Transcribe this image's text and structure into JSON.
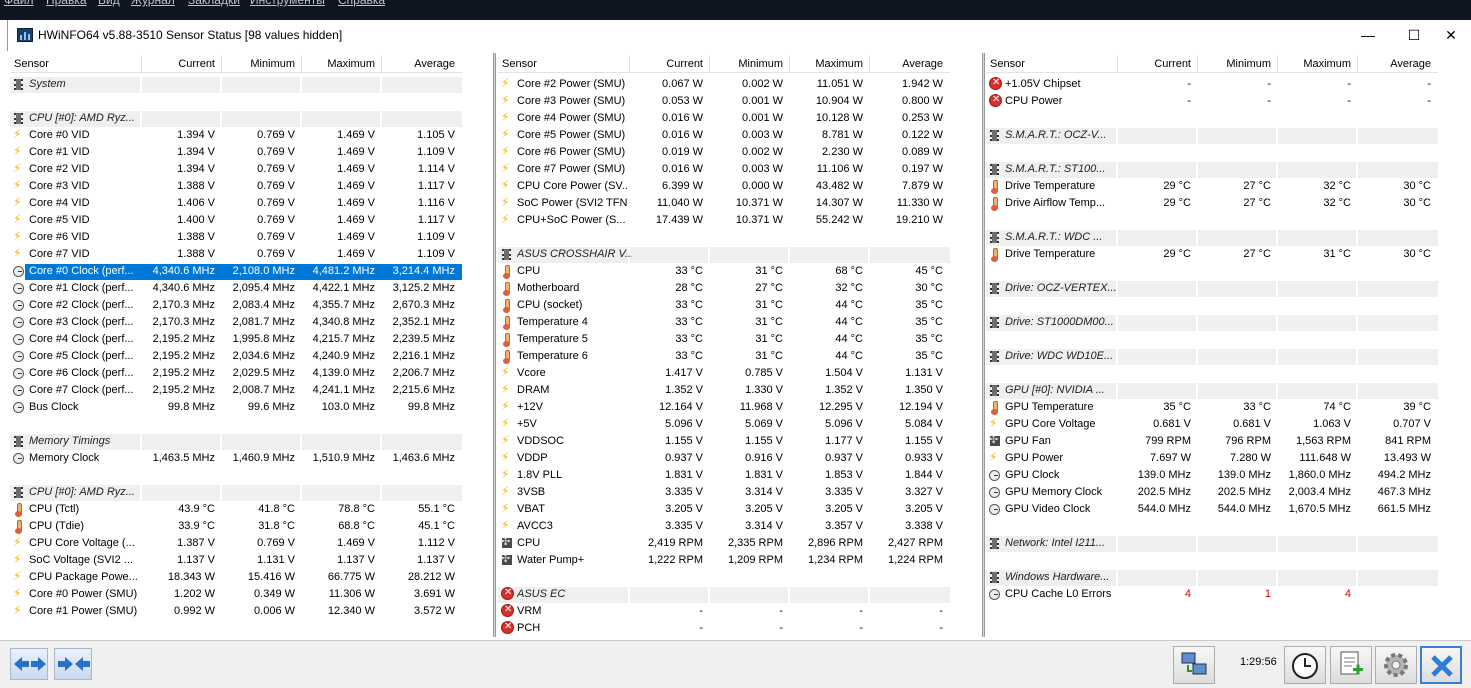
{
  "menu": [
    "Файл",
    "Правка",
    "Вид",
    "Журнал",
    "Закладки",
    "Инструменты",
    "Справка"
  ],
  "window": {
    "title": "HWiNFO64 v5.88-3510 Sensor Status [98 values hidden]",
    "minimize": "—",
    "maximize": "☐",
    "close": "✕"
  },
  "columns": {
    "sensor": "Sensor",
    "current": "Current",
    "minimum": "Minimum",
    "maximum": "Maximum",
    "average": "Average"
  },
  "panes": [
    {
      "rows": [
        {
          "type": "group",
          "name": "System"
        },
        {
          "type": "blank"
        },
        {
          "type": "group",
          "name": "CPU [#0]: AMD Ryz..."
        },
        {
          "icon": "bolt",
          "name": "Core #0 VID",
          "cur": "1.394 V",
          "min": "0.769 V",
          "max": "1.469 V",
          "avg": "1.105 V"
        },
        {
          "icon": "bolt",
          "name": "Core #1 VID",
          "cur": "1.394 V",
          "min": "0.769 V",
          "max": "1.469 V",
          "avg": "1.109 V"
        },
        {
          "icon": "bolt",
          "name": "Core #2 VID",
          "cur": "1.394 V",
          "min": "0.769 V",
          "max": "1.469 V",
          "avg": "1.114 V"
        },
        {
          "icon": "bolt",
          "name": "Core #3 VID",
          "cur": "1.388 V",
          "min": "0.769 V",
          "max": "1.469 V",
          "avg": "1.117 V"
        },
        {
          "icon": "bolt",
          "name": "Core #4 VID",
          "cur": "1.406 V",
          "min": "0.769 V",
          "max": "1.469 V",
          "avg": "1.116 V"
        },
        {
          "icon": "bolt",
          "name": "Core #5 VID",
          "cur": "1.400 V",
          "min": "0.769 V",
          "max": "1.469 V",
          "avg": "1.117 V"
        },
        {
          "icon": "bolt",
          "name": "Core #6 VID",
          "cur": "1.388 V",
          "min": "0.769 V",
          "max": "1.469 V",
          "avg": "1.109 V"
        },
        {
          "icon": "bolt",
          "name": "Core #7 VID",
          "cur": "1.388 V",
          "min": "0.769 V",
          "max": "1.469 V",
          "avg": "1.109 V"
        },
        {
          "icon": "clock",
          "name": "Core #0 Clock (perf...",
          "cur": "4,340.6 MHz",
          "min": "2,108.0 MHz",
          "max": "4,481.2 MHz",
          "avg": "3,214.4 MHz",
          "selected": true
        },
        {
          "icon": "clock",
          "name": "Core #1 Clock (perf...",
          "cur": "4,340.6 MHz",
          "min": "2,095.4 MHz",
          "max": "4,422.1 MHz",
          "avg": "3,125.2 MHz"
        },
        {
          "icon": "clock",
          "name": "Core #2 Clock (perf...",
          "cur": "2,170.3 MHz",
          "min": "2,083.4 MHz",
          "max": "4,355.7 MHz",
          "avg": "2,670.3 MHz"
        },
        {
          "icon": "clock",
          "name": "Core #3 Clock (perf...",
          "cur": "2,170.3 MHz",
          "min": "2,081.7 MHz",
          "max": "4,340.8 MHz",
          "avg": "2,352.1 MHz"
        },
        {
          "icon": "clock",
          "name": "Core #4 Clock (perf...",
          "cur": "2,195.2 MHz",
          "min": "1,995.8 MHz",
          "max": "4,215.7 MHz",
          "avg": "2,239.5 MHz"
        },
        {
          "icon": "clock",
          "name": "Core #5 Clock (perf...",
          "cur": "2,195.2 MHz",
          "min": "2,034.6 MHz",
          "max": "4,240.9 MHz",
          "avg": "2,216.1 MHz"
        },
        {
          "icon": "clock",
          "name": "Core #6 Clock (perf...",
          "cur": "2,195.2 MHz",
          "min": "2,029.5 MHz",
          "max": "4,139.0 MHz",
          "avg": "2,206.7 MHz"
        },
        {
          "icon": "clock",
          "name": "Core #7 Clock (perf...",
          "cur": "2,195.2 MHz",
          "min": "2,008.7 MHz",
          "max": "4,241.1 MHz",
          "avg": "2,215.6 MHz"
        },
        {
          "icon": "clock",
          "name": "Bus Clock",
          "cur": "99.8 MHz",
          "min": "99.6 MHz",
          "max": "103.0 MHz",
          "avg": "99.8 MHz"
        },
        {
          "type": "blank"
        },
        {
          "type": "group",
          "name": "Memory Timings"
        },
        {
          "icon": "clock",
          "name": "Memory Clock",
          "cur": "1,463.5 MHz",
          "min": "1,460.9 MHz",
          "max": "1,510.9 MHz",
          "avg": "1,463.6 MHz"
        },
        {
          "type": "blank"
        },
        {
          "type": "group",
          "name": "CPU [#0]: AMD Ryz..."
        },
        {
          "icon": "therm",
          "name": "CPU (Tctl)",
          "cur": "43.9 °C",
          "min": "41.8 °C",
          "max": "78.8 °C",
          "avg": "55.1 °C"
        },
        {
          "icon": "therm",
          "name": "CPU (Tdie)",
          "cur": "33.9 °C",
          "min": "31.8 °C",
          "max": "68.8 °C",
          "avg": "45.1 °C"
        },
        {
          "icon": "bolt",
          "name": "CPU Core Voltage (...",
          "cur": "1.387 V",
          "min": "0.769 V",
          "max": "1.469 V",
          "avg": "1.112 V"
        },
        {
          "icon": "bolt",
          "name": "SoC Voltage (SVI2 ...",
          "cur": "1.137 V",
          "min": "1.131 V",
          "max": "1.137 V",
          "avg": "1.137 V"
        },
        {
          "icon": "bolt",
          "name": "CPU Package Powe...",
          "cur": "18.343 W",
          "min": "15.416 W",
          "max": "66.775 W",
          "avg": "28.212 W"
        },
        {
          "icon": "bolt",
          "name": "Core #0 Power (SMU)",
          "cur": "1.202 W",
          "min": "0.349 W",
          "max": "11.306 W",
          "avg": "3.691 W"
        },
        {
          "icon": "bolt",
          "name": "Core #1 Power (SMU)",
          "cur": "0.992 W",
          "min": "0.006 W",
          "max": "12.340 W",
          "avg": "3.572 W"
        }
      ]
    },
    {
      "rows": [
        {
          "icon": "bolt",
          "name": "Core #2 Power (SMU)",
          "cur": "0.067 W",
          "min": "0.002 W",
          "max": "11.051 W",
          "avg": "1.942 W"
        },
        {
          "icon": "bolt",
          "name": "Core #3 Power (SMU)",
          "cur": "0.053 W",
          "min": "0.001 W",
          "max": "10.904 W",
          "avg": "0.800 W"
        },
        {
          "icon": "bolt",
          "name": "Core #4 Power (SMU)",
          "cur": "0.016 W",
          "min": "0.001 W",
          "max": "10.128 W",
          "avg": "0.253 W"
        },
        {
          "icon": "bolt",
          "name": "Core #5 Power (SMU)",
          "cur": "0.016 W",
          "min": "0.003 W",
          "max": "8.781 W",
          "avg": "0.122 W"
        },
        {
          "icon": "bolt",
          "name": "Core #6 Power (SMU)",
          "cur": "0.019 W",
          "min": "0.002 W",
          "max": "2.230 W",
          "avg": "0.089 W"
        },
        {
          "icon": "bolt",
          "name": "Core #7 Power (SMU)",
          "cur": "0.016 W",
          "min": "0.003 W",
          "max": "11.106 W",
          "avg": "0.197 W"
        },
        {
          "icon": "bolt",
          "name": "CPU Core Power (SV...",
          "cur": "6.399 W",
          "min": "0.000 W",
          "max": "43.482 W",
          "avg": "7.879 W"
        },
        {
          "icon": "bolt",
          "name": "SoC Power (SVI2 TFN)",
          "cur": "11.040 W",
          "min": "10.371 W",
          "max": "14.307 W",
          "avg": "11.330 W"
        },
        {
          "icon": "bolt",
          "name": "CPU+SoC Power (S...",
          "cur": "17.439 W",
          "min": "10.371 W",
          "max": "55.242 W",
          "avg": "19.210 W"
        },
        {
          "type": "blank"
        },
        {
          "type": "group",
          "name": "ASUS CROSSHAIR V..."
        },
        {
          "icon": "therm",
          "name": "CPU",
          "cur": "33 °C",
          "min": "31 °C",
          "max": "68 °C",
          "avg": "45 °C"
        },
        {
          "icon": "therm",
          "name": "Motherboard",
          "cur": "28 °C",
          "min": "27 °C",
          "max": "32 °C",
          "avg": "30 °C"
        },
        {
          "icon": "therm",
          "name": "CPU (socket)",
          "cur": "33 °C",
          "min": "31 °C",
          "max": "44 °C",
          "avg": "35 °C"
        },
        {
          "icon": "therm",
          "name": "Temperature 4",
          "cur": "33 °C",
          "min": "31 °C",
          "max": "44 °C",
          "avg": "35 °C"
        },
        {
          "icon": "therm",
          "name": "Temperature 5",
          "cur": "33 °C",
          "min": "31 °C",
          "max": "44 °C",
          "avg": "35 °C"
        },
        {
          "icon": "therm",
          "name": "Temperature 6",
          "cur": "33 °C",
          "min": "31 °C",
          "max": "44 °C",
          "avg": "35 °C"
        },
        {
          "icon": "bolt",
          "name": "Vcore",
          "cur": "1.417 V",
          "min": "0.785 V",
          "max": "1.504 V",
          "avg": "1.131 V"
        },
        {
          "icon": "bolt",
          "name": "DRAM",
          "cur": "1.352 V",
          "min": "1.330 V",
          "max": "1.352 V",
          "avg": "1.350 V"
        },
        {
          "icon": "bolt",
          "name": "+12V",
          "cur": "12.164 V",
          "min": "11.968 V",
          "max": "12.295 V",
          "avg": "12.194 V"
        },
        {
          "icon": "bolt",
          "name": "+5V",
          "cur": "5.096 V",
          "min": "5.069 V",
          "max": "5.096 V",
          "avg": "5.084 V"
        },
        {
          "icon": "bolt",
          "name": "VDDSOC",
          "cur": "1.155 V",
          "min": "1.155 V",
          "max": "1.177 V",
          "avg": "1.155 V"
        },
        {
          "icon": "bolt",
          "name": "VDDP",
          "cur": "0.937 V",
          "min": "0.916 V",
          "max": "0.937 V",
          "avg": "0.933 V"
        },
        {
          "icon": "bolt",
          "name": "1.8V PLL",
          "cur": "1.831 V",
          "min": "1.831 V",
          "max": "1.853 V",
          "avg": "1.844 V"
        },
        {
          "icon": "bolt",
          "name": "3VSB",
          "cur": "3.335 V",
          "min": "3.314 V",
          "max": "3.335 V",
          "avg": "3.327 V"
        },
        {
          "icon": "bolt",
          "name": "VBAT",
          "cur": "3.205 V",
          "min": "3.205 V",
          "max": "3.205 V",
          "avg": "3.205 V"
        },
        {
          "icon": "bolt",
          "name": "AVCC3",
          "cur": "3.335 V",
          "min": "3.314 V",
          "max": "3.357 V",
          "avg": "3.338 V"
        },
        {
          "icon": "fan",
          "name": "CPU",
          "cur": "2,419 RPM",
          "min": "2,335 RPM",
          "max": "2,896 RPM",
          "avg": "2,427 RPM"
        },
        {
          "icon": "fan",
          "name": "Water Pump+",
          "cur": "1,222 RPM",
          "min": "1,209 RPM",
          "max": "1,234 RPM",
          "avg": "1,224 RPM"
        },
        {
          "type": "blank"
        },
        {
          "type": "group",
          "icon": "err",
          "name": "ASUS EC",
          "gray": true
        },
        {
          "icon": "err",
          "name": "VRM",
          "cur": "-",
          "min": "-",
          "max": "-",
          "avg": "-"
        },
        {
          "icon": "err",
          "name": "PCH",
          "cur": "-",
          "min": "-",
          "max": "-",
          "avg": "-"
        }
      ]
    },
    {
      "rows": [
        {
          "icon": "err",
          "name": "+1.05V Chipset",
          "cur": "-",
          "min": "-",
          "max": "-",
          "avg": "-"
        },
        {
          "icon": "err",
          "name": "CPU Power",
          "cur": "-",
          "min": "-",
          "max": "-",
          "avg": "-"
        },
        {
          "type": "blank"
        },
        {
          "type": "group",
          "name": "S.M.A.R.T.: OCZ-V..."
        },
        {
          "type": "blank"
        },
        {
          "type": "group",
          "name": "S.M.A.R.T.: ST100..."
        },
        {
          "icon": "therm",
          "name": "Drive Temperature",
          "cur": "29 °C",
          "min": "27 °C",
          "max": "32 °C",
          "avg": "30 °C"
        },
        {
          "icon": "therm",
          "name": "Drive Airflow Temp...",
          "cur": "29 °C",
          "min": "27 °C",
          "max": "32 °C",
          "avg": "30 °C"
        },
        {
          "type": "blank"
        },
        {
          "type": "group",
          "name": "S.M.A.R.T.: WDC ..."
        },
        {
          "icon": "therm",
          "name": "Drive Temperature",
          "cur": "29 °C",
          "min": "27 °C",
          "max": "31 °C",
          "avg": "30 °C"
        },
        {
          "type": "blank"
        },
        {
          "type": "group",
          "name": "Drive: OCZ-VERTEX..."
        },
        {
          "type": "blank"
        },
        {
          "type": "group",
          "name": "Drive: ST1000DM00..."
        },
        {
          "type": "blank"
        },
        {
          "type": "group",
          "name": "Drive: WDC WD10E..."
        },
        {
          "type": "blank"
        },
        {
          "type": "group",
          "name": "GPU [#0]: NVIDIA ..."
        },
        {
          "icon": "therm",
          "name": "GPU Temperature",
          "cur": "35 °C",
          "min": "33 °C",
          "max": "74 °C",
          "avg": "39 °C"
        },
        {
          "icon": "bolt",
          "name": "GPU Core Voltage",
          "cur": "0.681 V",
          "min": "0.681 V",
          "max": "1.063 V",
          "avg": "0.707 V"
        },
        {
          "icon": "fan",
          "name": "GPU Fan",
          "cur": "799 RPM",
          "min": "796 RPM",
          "max": "1,563 RPM",
          "avg": "841 RPM"
        },
        {
          "icon": "bolt",
          "name": "GPU Power",
          "cur": "7.697 W",
          "min": "7.280 W",
          "max": "111.648 W",
          "avg": "13.493 W"
        },
        {
          "icon": "clock",
          "name": "GPU Clock",
          "cur": "139.0 MHz",
          "min": "139.0 MHz",
          "max": "1,860.0 MHz",
          "avg": "494.2 MHz"
        },
        {
          "icon": "clock",
          "name": "GPU Memory Clock",
          "cur": "202.5 MHz",
          "min": "202.5 MHz",
          "max": "2,003.4 MHz",
          "avg": "467.3 MHz"
        },
        {
          "icon": "clock",
          "name": "GPU Video Clock",
          "cur": "544.0 MHz",
          "min": "544.0 MHz",
          "max": "1,670.5 MHz",
          "avg": "661.5 MHz"
        },
        {
          "type": "blank"
        },
        {
          "type": "group",
          "name": "Network: Intel I211..."
        },
        {
          "type": "blank"
        },
        {
          "type": "group",
          "name": "Windows Hardware..."
        },
        {
          "icon": "clock",
          "name": "CPU Cache L0 Errors",
          "cur": "4",
          "min": "1",
          "max": "4",
          "avg": "",
          "red": true
        }
      ]
    }
  ],
  "status": {
    "elapsed": "1:29:56"
  },
  "colors": {
    "selection": "#0078d7",
    "error_value": "#d00000",
    "accent_border": "#3b7fd0"
  }
}
